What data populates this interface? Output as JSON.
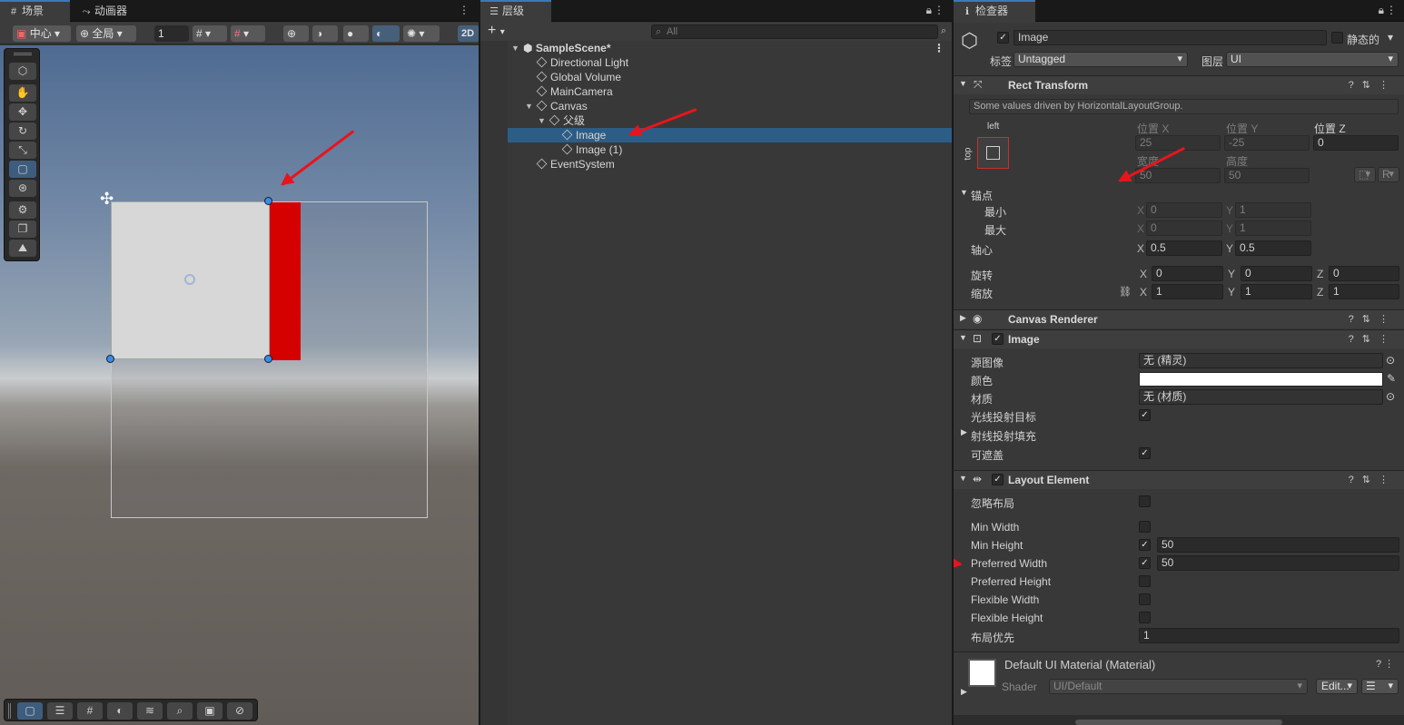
{
  "scene": {
    "tabs": [
      "场景",
      "动画器"
    ],
    "toolbar": {
      "pivot": "中心",
      "space": "全局",
      "snap_value": "1",
      "mode_2d": "2D"
    }
  },
  "hierarchy": {
    "tab": "层级",
    "search_placeholder": "All",
    "items": [
      {
        "label": "SampleScene*"
      },
      {
        "label": "Directional Light"
      },
      {
        "label": "Global Volume"
      },
      {
        "label": "MainCamera"
      },
      {
        "label": "Canvas"
      },
      {
        "label": "父级"
      },
      {
        "label": "Image"
      },
      {
        "label": "Image (1)"
      },
      {
        "label": "EventSystem"
      }
    ]
  },
  "inspector": {
    "tab": "检查器",
    "object_name": "Image",
    "static_label": "静态的",
    "tag_label": "标签",
    "tag_value": "Untagged",
    "layer_label": "图层",
    "layer_value": "UI",
    "rect_transform": {
      "title": "Rect Transform",
      "notice": "Some values driven by HorizontalLayoutGroup.",
      "anchor_h": "left",
      "anchor_v": "top",
      "pos_x_label": "位置 X",
      "pos_y_label": "位置 Y",
      "pos_z_label": "位置 Z",
      "pos_x": "25",
      "pos_y": "-25",
      "pos_z": "0",
      "width_label": "宽度",
      "height_label": "高度",
      "width": "50",
      "height": "50",
      "r_button": "R",
      "anchors_label": "锚点",
      "min_label": "最小",
      "max_label": "最大",
      "min_x": "0",
      "min_y": "1",
      "max_x": "0",
      "max_y": "1",
      "pivot_label": "轴心",
      "pivot_x": "0.5",
      "pivot_y": "0.5",
      "rotation_label": "旋转",
      "rot_x": "0",
      "rot_y": "0",
      "rot_z": "0",
      "scale_label": "缩放",
      "scale_x": "1",
      "scale_y": "1",
      "scale_z": "1",
      "axis_x": "X",
      "axis_y": "Y",
      "axis_z": "Z"
    },
    "canvas_renderer": {
      "title": "Canvas Renderer"
    },
    "image": {
      "title": "Image",
      "source_label": "源图像",
      "source_value": "无 (精灵)",
      "color_label": "颜色",
      "color_value": "#ffffff",
      "material_label": "材质",
      "material_value": "无 (材质)",
      "raycast_target_label": "光线投射目标",
      "raycast_padding_label": "射线投射填充",
      "maskable_label": "可遮盖"
    },
    "layout_element": {
      "title": "Layout Element",
      "ignore_layout_label": "忽略布局",
      "min_width_label": "Min Width",
      "min_height_label": "Min Height",
      "min_height_value": "50",
      "preferred_width_label": "Preferred Width",
      "preferred_width_value": "50",
      "preferred_height_label": "Preferred Height",
      "flexible_width_label": "Flexible Width",
      "flexible_height_label": "Flexible Height",
      "priority_label": "布局优先",
      "priority_value": "1"
    },
    "material": {
      "title": "Default UI Material (Material)",
      "shader_label": "Shader",
      "shader_value": "UI/Default",
      "edit_button": "Edit..."
    }
  },
  "colors": {
    "selection": "#2c5d87",
    "accent_red": "#d50000",
    "tab_highlight": "#3a79bb"
  }
}
